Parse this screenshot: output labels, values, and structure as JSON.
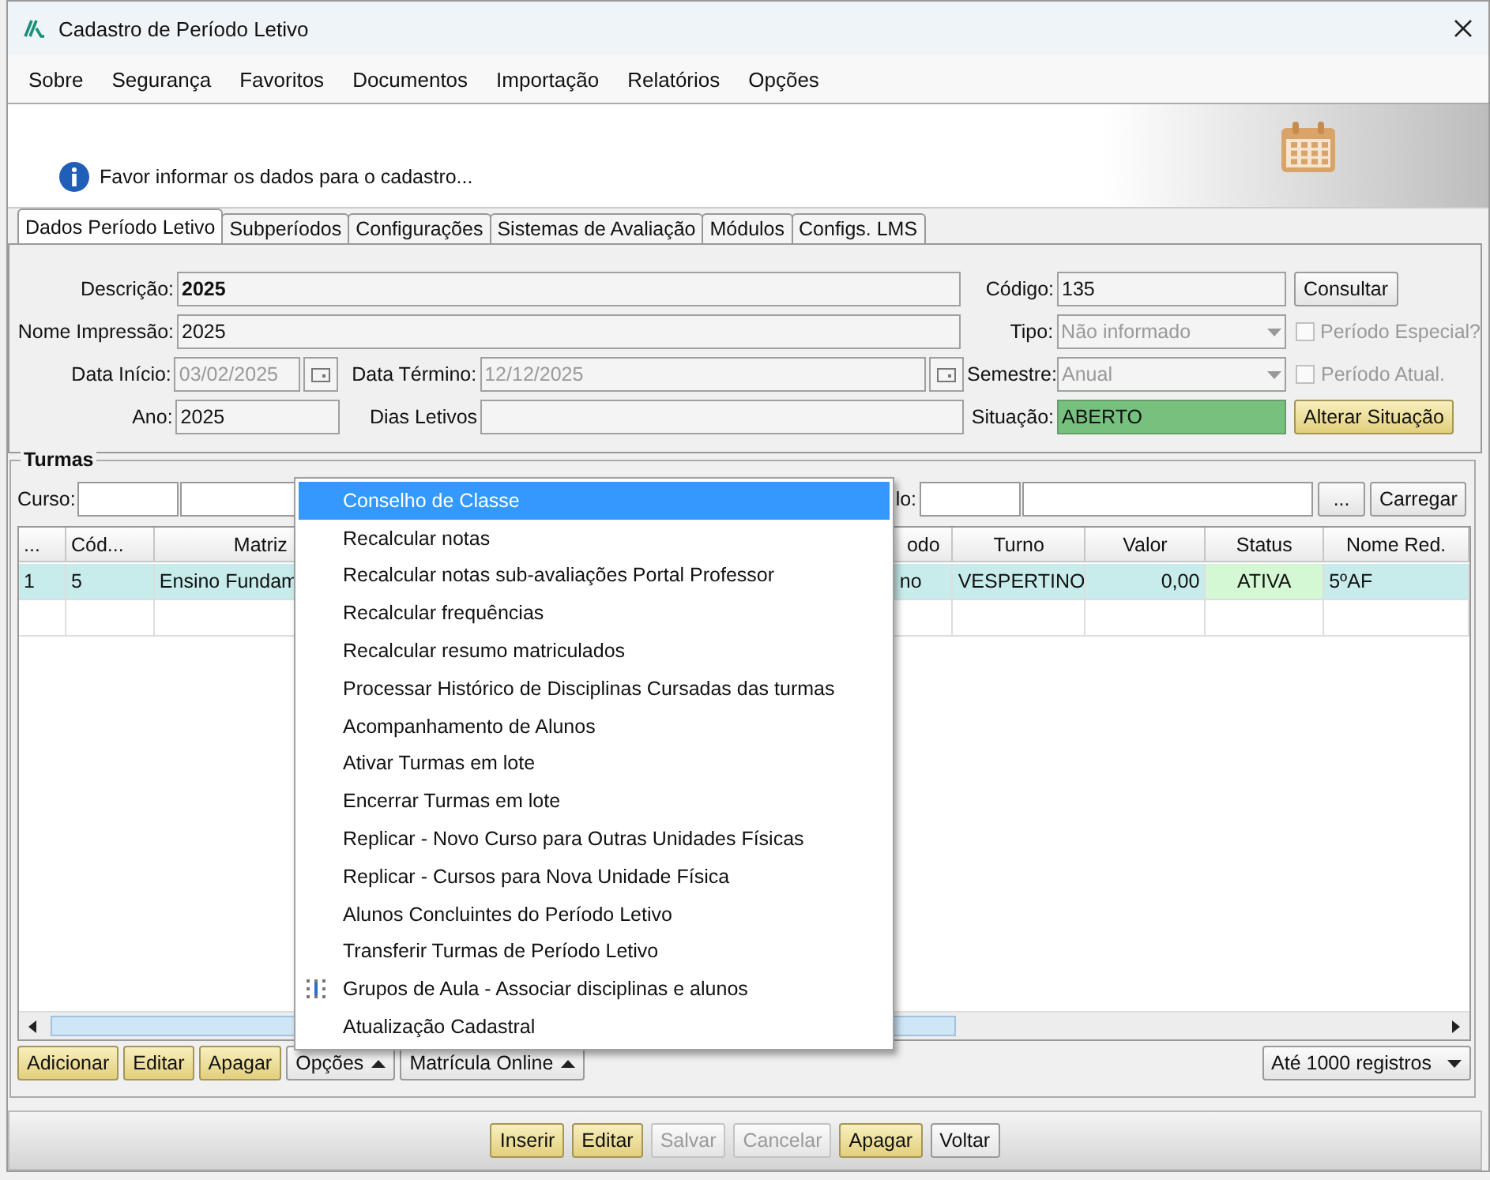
{
  "window": {
    "title": "Cadastro de Período Letivo"
  },
  "menu": [
    "Sobre",
    "Segurança",
    "Favoritos",
    "Documentos",
    "Importação",
    "Relatórios",
    "Opções"
  ],
  "banner": {
    "message": "Favor informar os dados para o cadastro..."
  },
  "tabs": [
    {
      "label": "Dados Período Letivo",
      "selected": true
    },
    {
      "label": "Subperíodos",
      "selected": false
    },
    {
      "label": "Configurações",
      "selected": false
    },
    {
      "label": "Sistemas de Avaliação",
      "selected": false
    },
    {
      "label": "Módulos",
      "selected": false
    },
    {
      "label": "Configs. LMS",
      "selected": false
    }
  ],
  "form": {
    "description": {
      "label": "Descrição:",
      "value": "2025",
      "disabled": false
    },
    "print_name": {
      "label": "Nome Impressão:",
      "value": "2025",
      "disabled": false
    },
    "start_date": {
      "label": "Data Início:",
      "value": "03/02/2025",
      "disabled": true
    },
    "end_date": {
      "label": "Data Término:",
      "value": "12/12/2025",
      "disabled": true
    },
    "year": {
      "label": "Ano:",
      "value": "2025",
      "disabled": false
    },
    "school_days": {
      "label": "Dias Letivos"
    },
    "code": {
      "label": "Código:",
      "value": "135",
      "disabled": false
    },
    "lookup_button": {
      "label": "Consultar"
    },
    "type": {
      "label": "Tipo:",
      "value": "Não informado",
      "disabled": true
    },
    "special_period": {
      "label": "Período Especial?",
      "checked": false,
      "disabled": true
    },
    "semester": {
      "label": "Semestre:",
      "value": "Anual",
      "disabled": true
    },
    "current_period": {
      "label": "Período Atual.",
      "checked": false,
      "disabled": true
    },
    "status": {
      "label": "Situação:",
      "value": "ABERTO",
      "color": "#77c17f"
    },
    "change_status_button": {
      "label": "Alterar Situação"
    }
  },
  "turmas": {
    "title": "Turmas",
    "course_label": "Curso:",
    "second_filter_label": "lo:",
    "browse_button": "...",
    "load_button": "Carregar",
    "columns": [
      {
        "label": "...",
        "kind": "text"
      },
      {
        "label": "Cód...",
        "kind": "text"
      },
      {
        "label": "Matriz",
        "kind": "wide"
      },
      {
        "label": "odo",
        "kind": "text"
      },
      {
        "label": "Turno",
        "kind": "text"
      },
      {
        "label": "Valor",
        "kind": "number"
      },
      {
        "label": "Status",
        "kind": "status"
      },
      {
        "label": "Nome Red.",
        "kind": "text"
      }
    ],
    "rows": [
      {
        "cells": [
          "1",
          "5",
          "Ensino Fundam",
          "no",
          "VESPERTINO",
          "0,00",
          "ATIVA",
          "5ºAF"
        ],
        "selected": true
      }
    ],
    "actions": [
      {
        "label": "Adicionar",
        "kind": "highlight"
      },
      {
        "label": "Editar",
        "kind": "highlight"
      },
      {
        "label": "Apagar",
        "kind": "highlight"
      },
      {
        "label": "Opções",
        "kind": "dropdown"
      },
      {
        "label": "Matrícula Online",
        "kind": "dropdown"
      }
    ],
    "limit": {
      "value": "Até 1000 registros"
    }
  },
  "popup_menu": [
    {
      "label": "Conselho de Classe",
      "selected": true,
      "kind": "plain"
    },
    {
      "label": "Recalcular notas",
      "selected": false,
      "kind": "plain"
    },
    {
      "label": "Recalcular notas sub-avaliações Portal Professor",
      "selected": false,
      "kind": "plain"
    },
    {
      "label": "Recalcular frequências",
      "selected": false,
      "kind": "plain"
    },
    {
      "label": "Recalcular resumo matriculados",
      "selected": false,
      "kind": "plain"
    },
    {
      "label": "Processar Histórico de Disciplinas Cursadas das turmas",
      "selected": false,
      "kind": "plain"
    },
    {
      "label": "Acompanhamento de Alunos",
      "selected": false,
      "kind": "plain"
    },
    {
      "label": "Ativar Turmas em lote",
      "selected": false,
      "kind": "plain"
    },
    {
      "label": "Encerrar Turmas em lote",
      "selected": false,
      "kind": "plain"
    },
    {
      "label": "Replicar - Novo Curso para Outras Unidades Físicas",
      "selected": false,
      "kind": "plain"
    },
    {
      "label": "Replicar - Cursos para Nova Unidade Física",
      "selected": false,
      "kind": "plain"
    },
    {
      "label": "Alunos Concluintes do Período Letivo",
      "selected": false,
      "kind": "plain"
    },
    {
      "label": "Transferir Turmas de Período Letivo",
      "selected": false,
      "kind": "plain"
    },
    {
      "label": "Grupos de Aula - Associar disciplinas e alunos",
      "selected": false,
      "kind": "icon"
    },
    {
      "label": "Atualização Cadastral",
      "selected": false,
      "kind": "plain"
    }
  ],
  "footer": [
    {
      "label": "Inserir",
      "kind": "highlight",
      "disabled": false
    },
    {
      "label": "Editar",
      "kind": "highlight",
      "disabled": false
    },
    {
      "label": "Salvar",
      "kind": "normal",
      "disabled": true
    },
    {
      "label": "Cancelar",
      "kind": "normal",
      "disabled": true
    },
    {
      "label": "Apagar",
      "kind": "highlight",
      "disabled": false
    },
    {
      "label": "Voltar",
      "kind": "normal",
      "disabled": false
    }
  ]
}
